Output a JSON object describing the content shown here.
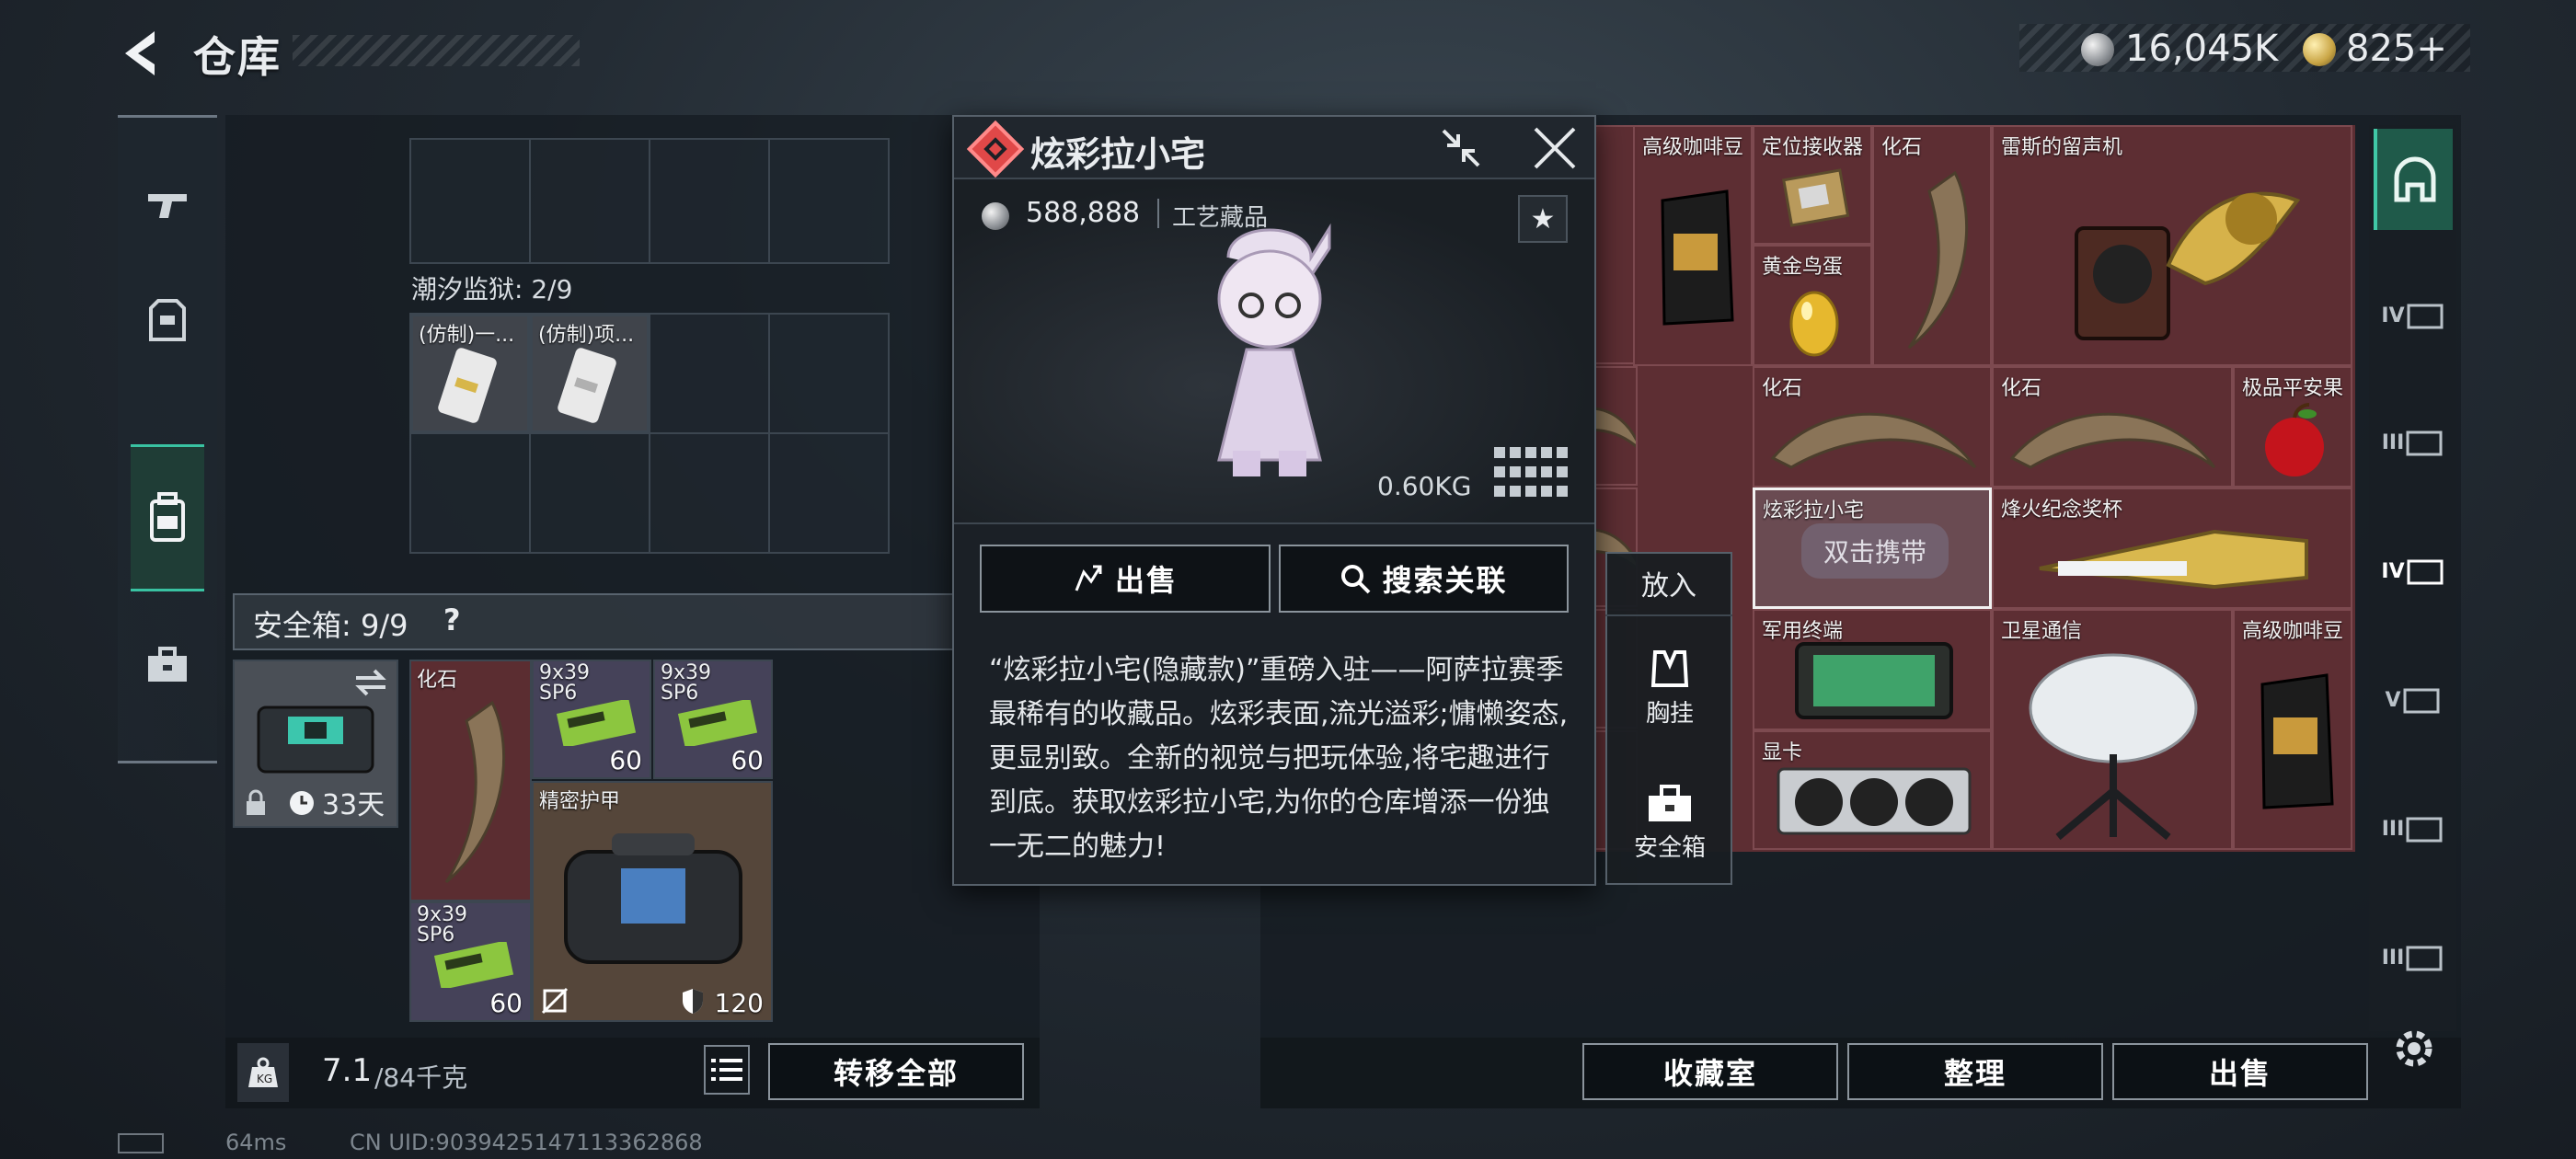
{
  "header": {
    "title": "仓库",
    "currency_silver": "16,045K",
    "currency_gold": "825",
    "currency_gold_plus": "+"
  },
  "left_panel": {
    "prison_label": "潮汐监狱: 2/9",
    "prison_items": [
      {
        "name": "(仿制)一..."
      },
      {
        "name": "(仿制)项..."
      }
    ],
    "safebox_label": "安全箱: 9/9",
    "safebox_help": "?",
    "safebox_timer": "33天",
    "safe_items": [
      {
        "name": "化石",
        "qty": ""
      },
      {
        "name": "9x39 SP6",
        "qty": "60"
      },
      {
        "name": "9x39 SP6",
        "qty": "60"
      },
      {
        "name": "精密护甲",
        "qty": "120"
      },
      {
        "name": "9x39 SP6",
        "qty": "60"
      }
    ],
    "weight_main": "7.1",
    "weight_sub": "/84千克",
    "transfer_all": "转移全部"
  },
  "popup": {
    "title": "炫彩拉小宅",
    "price": "588,888",
    "category": "工艺藏品",
    "weight": "0.60KG",
    "sell": "出售",
    "search": "搜索关联",
    "description": "“炫彩拉小宅(隐藏款)”重磅入驻——阿萨拉赛季最稀有的收藏品。炫彩表面,流光溢彩;慵懒姿态,更显别致。全新的视觉与把玩体验,将宅趣进行到底。获取炫彩拉小宅,为你的仓库增添一份独一无二的魅力!"
  },
  "side_actions": {
    "put_in": "放入",
    "chest_rig": "胸挂",
    "safebox": "安全箱"
  },
  "right_panel": {
    "items": [
      {
        "name": "高级咖啡豆"
      },
      {
        "name": "定位接收器"
      },
      {
        "name": "化石"
      },
      {
        "name": "雷斯的留声机"
      },
      {
        "name": "黄金鸟蛋"
      },
      {
        "name": "化石"
      },
      {
        "name": "化石"
      },
      {
        "name": "极品平安果"
      },
      {
        "name": "炫彩拉小宅"
      },
      {
        "name": "烽火纪念奖杯"
      },
      {
        "name": "军用终端"
      },
      {
        "name": "卫星通信"
      },
      {
        "name": "高级咖啡豆"
      },
      {
        "name": "显卡"
      }
    ],
    "double_tap_hint": "双击携带",
    "collection_room": "收藏室",
    "organize": "整理",
    "sell": "出售"
  },
  "rail": {
    "tabs": [
      "IV",
      "III",
      "IV",
      "V",
      "III",
      "III"
    ]
  },
  "status": {
    "ping": "64ms",
    "uid": "CN UID:9039425147113362868"
  },
  "colors": {
    "accent": "#39c2a2",
    "rare_red": "#5d2e33",
    "gem_red": "#e04848"
  }
}
